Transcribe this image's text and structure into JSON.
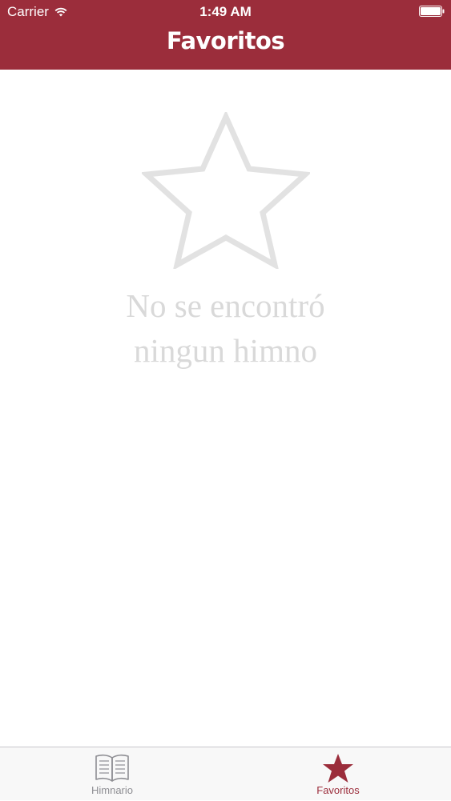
{
  "status_bar": {
    "carrier": "Carrier",
    "time": "1:49 AM"
  },
  "header": {
    "title": "Favoritos"
  },
  "empty_state": {
    "icon": "star-outline-icon",
    "line1": "No se encontró",
    "line2": "ningun himno"
  },
  "tabbar": {
    "tabs": [
      {
        "label": "Himnario",
        "icon": "book-icon",
        "selected": false
      },
      {
        "label": "Favoritos",
        "icon": "star-icon",
        "selected": true
      }
    ]
  },
  "colors": {
    "accent": "#9b2d3b",
    "empty_text": "#d9d9d9",
    "inactive_tab": "#8e8e93"
  }
}
